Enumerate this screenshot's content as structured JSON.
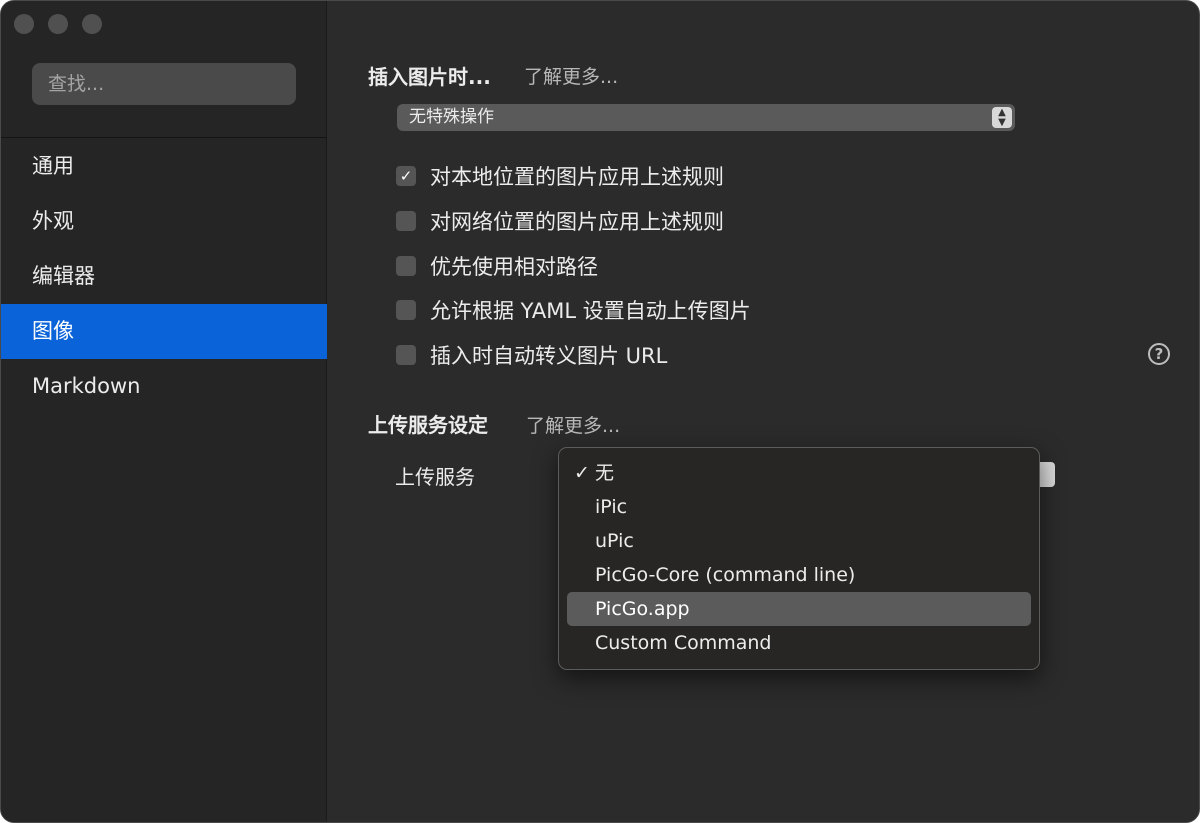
{
  "sidebar": {
    "search_placeholder": "查找...",
    "items": [
      {
        "label": "通用",
        "active": false
      },
      {
        "label": "外观",
        "active": false
      },
      {
        "label": "编辑器",
        "active": false
      },
      {
        "label": "图像",
        "active": true
      },
      {
        "label": "Markdown",
        "active": false
      }
    ]
  },
  "insert_section": {
    "title": "插入图片时...",
    "learn_more": "了解更多...",
    "action_select": {
      "value": "无特殊操作",
      "stepper_icon": "up-down-chevron-icon"
    },
    "options": [
      {
        "label": "对本地位置的图片应用上述规则",
        "checked": true
      },
      {
        "label": "对网络位置的图片应用上述规则",
        "checked": false
      },
      {
        "label": "优先使用相对路径",
        "checked": false
      },
      {
        "label": "允许根据 YAML 设置自动上传图片",
        "checked": false
      },
      {
        "label": "插入时自动转义图片 URL",
        "checked": false
      }
    ],
    "help_icon": "question-mark-icon",
    "help_symbol": "?"
  },
  "upload_section": {
    "title": "上传服务设定",
    "learn_more": "了解更多...",
    "service_label": "上传服务",
    "menu": {
      "check_symbol": "✓",
      "items": [
        {
          "label": "无",
          "checked": true,
          "highlighted": false
        },
        {
          "label": "iPic",
          "checked": false,
          "highlighted": false
        },
        {
          "label": "uPic",
          "checked": false,
          "highlighted": false
        },
        {
          "label": "PicGo-Core (command line)",
          "checked": false,
          "highlighted": false
        },
        {
          "label": "PicGo.app",
          "checked": false,
          "highlighted": true
        },
        {
          "label": "Custom Command",
          "checked": false,
          "highlighted": false
        }
      ]
    }
  },
  "colors": {
    "window_bg": "#2b2b2b",
    "sidebar_bg": "#252525",
    "accent": "#0a63d8",
    "menu_highlight": "#5b5b5b"
  }
}
